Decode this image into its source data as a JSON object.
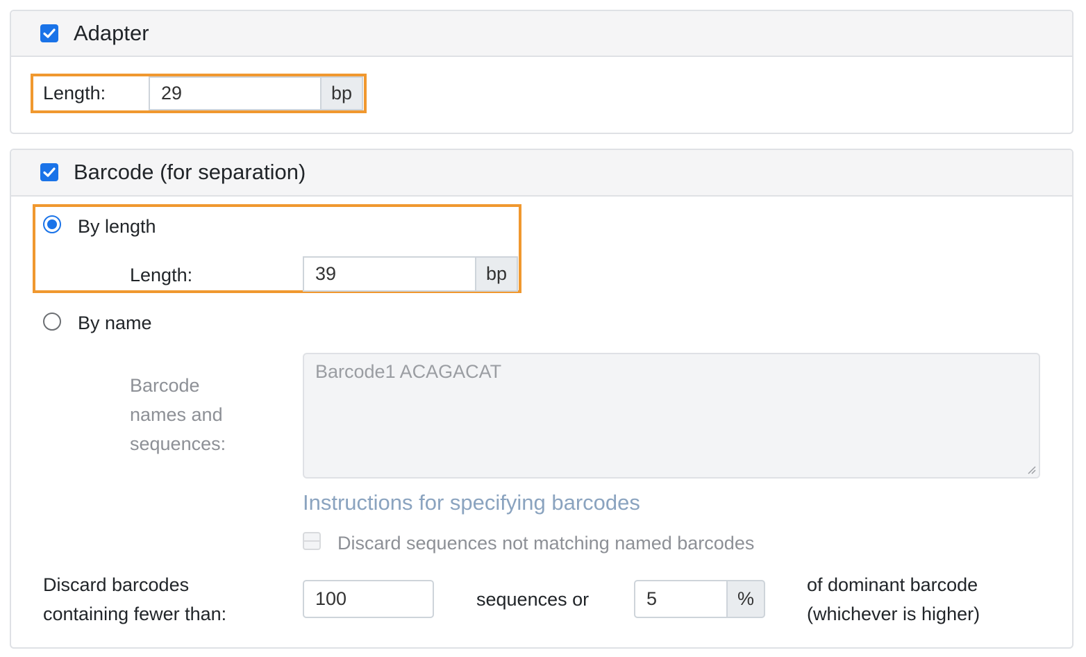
{
  "adapter": {
    "title": "Adapter",
    "checked": true,
    "length_label": "Length:",
    "length_value": "29",
    "unit": "bp"
  },
  "barcode": {
    "title": "Barcode (for separation)",
    "checked": true,
    "by_length": {
      "label": "By length",
      "selected": true,
      "length_label": "Length:",
      "length_value": "39",
      "unit": "bp"
    },
    "by_name": {
      "label": "By name",
      "selected": false,
      "field_label_line1": "Barcode",
      "field_label_line2": "names and",
      "field_label_line3": "sequences:",
      "placeholder": "Barcode1 ACAGACAT",
      "instructions_link": "Instructions for specifying barcodes",
      "discard_unmatched_label": "Discard sequences not matching named barcodes"
    },
    "discard": {
      "label_line1": "Discard barcodes",
      "label_line2": "containing fewer than:",
      "sequences_value": "100",
      "sequences_or": "sequences or",
      "percent_value": "5",
      "percent_unit": "%",
      "suffix_line1": "of dominant barcode",
      "suffix_line2": "(whichever is higher)"
    }
  },
  "colors": {
    "accent": "#1a73e8",
    "highlight": "#f0982f",
    "link": "#8aa3bf"
  }
}
